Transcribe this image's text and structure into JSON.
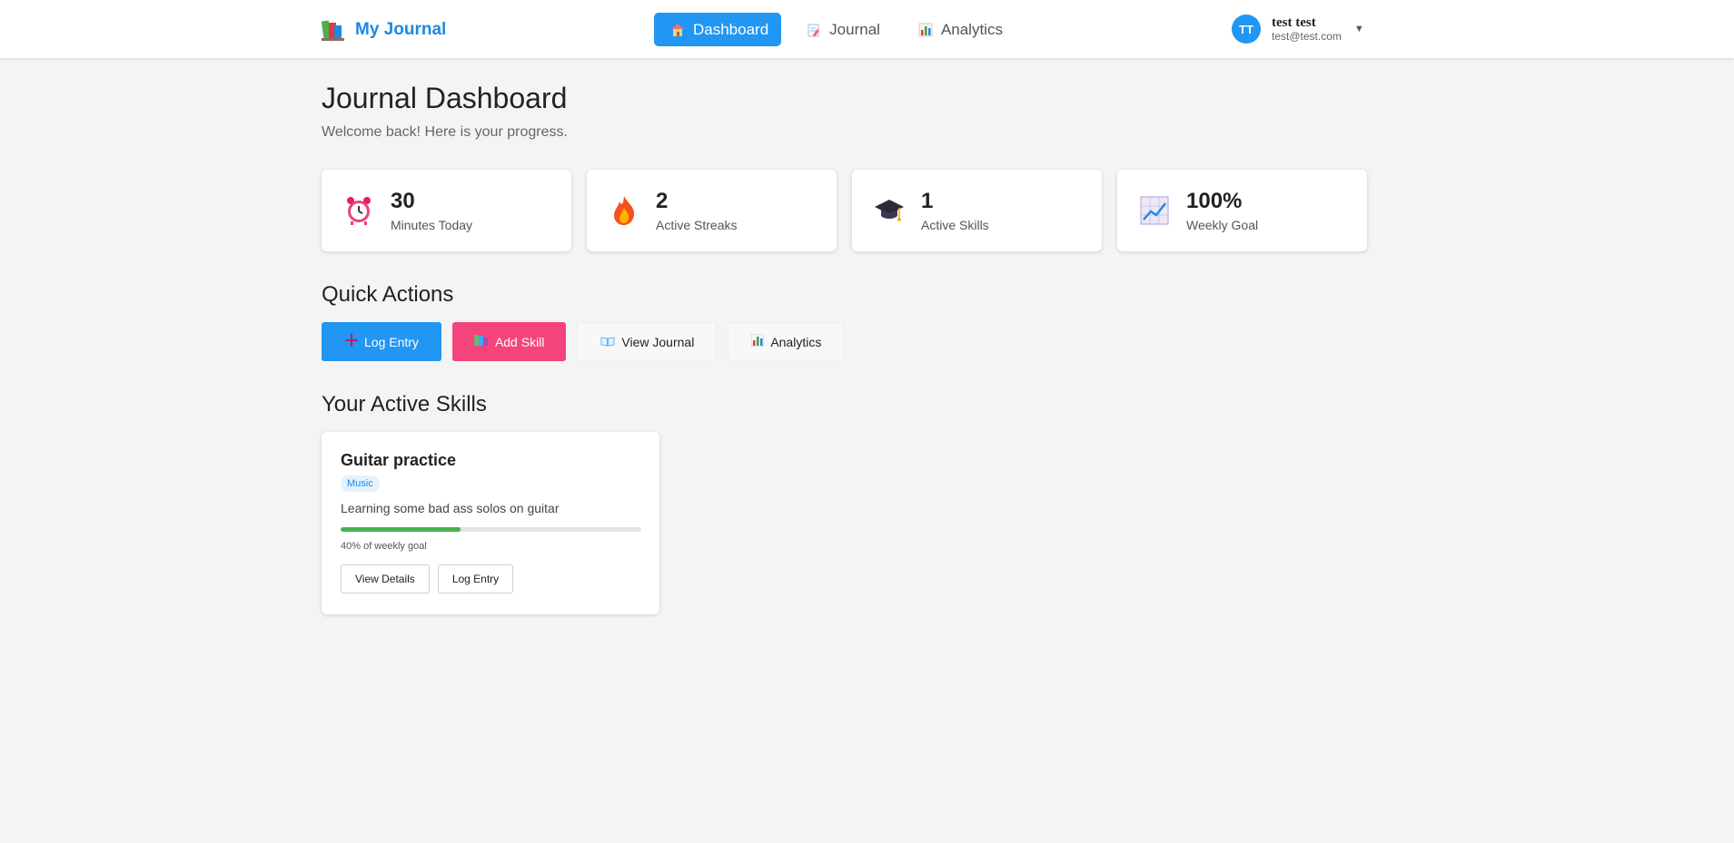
{
  "header": {
    "brand": "My Journal",
    "nav": [
      {
        "label": "Dashboard",
        "icon": "house-icon",
        "active": true
      },
      {
        "label": "Journal",
        "icon": "memo-icon",
        "active": false
      },
      {
        "label": "Analytics",
        "icon": "bar-chart-icon",
        "active": false
      }
    ],
    "user": {
      "initials": "TT",
      "name": "test test",
      "email": "test@test.com",
      "caret": "▼"
    }
  },
  "page": {
    "title": "Journal Dashboard",
    "subtitle": "Welcome back! Here is your progress."
  },
  "stats": [
    {
      "value": "30",
      "label": "Minutes Today",
      "icon": "alarm-clock-icon"
    },
    {
      "value": "2",
      "label": "Active Streaks",
      "icon": "fire-icon"
    },
    {
      "value": "1",
      "label": "Active Skills",
      "icon": "graduation-cap-icon"
    },
    {
      "value": "100%",
      "label": "Weekly Goal",
      "icon": "trend-chart-icon"
    }
  ],
  "quick_actions": {
    "title": "Quick Actions",
    "buttons": [
      {
        "label": "Log Entry",
        "icon": "plus-icon"
      },
      {
        "label": "Add Skill",
        "icon": "books-icon"
      },
      {
        "label": "View Journal",
        "icon": "open-book-icon"
      },
      {
        "label": "Analytics",
        "icon": "bar-chart-icon"
      }
    ]
  },
  "skills": {
    "title": "Your Active Skills",
    "items": [
      {
        "name": "Guitar practice",
        "category": "Music",
        "description": "Learning some bad ass solos on guitar",
        "progress": 0.4,
        "progress_text": "40% of weekly goal",
        "view_label": "View Details",
        "log_label": "Log Entry"
      }
    ]
  },
  "colors": {
    "primary": "#2196f3",
    "pink": "#f5437c",
    "progress": "#4caf50",
    "background": "#f4f4f4"
  }
}
